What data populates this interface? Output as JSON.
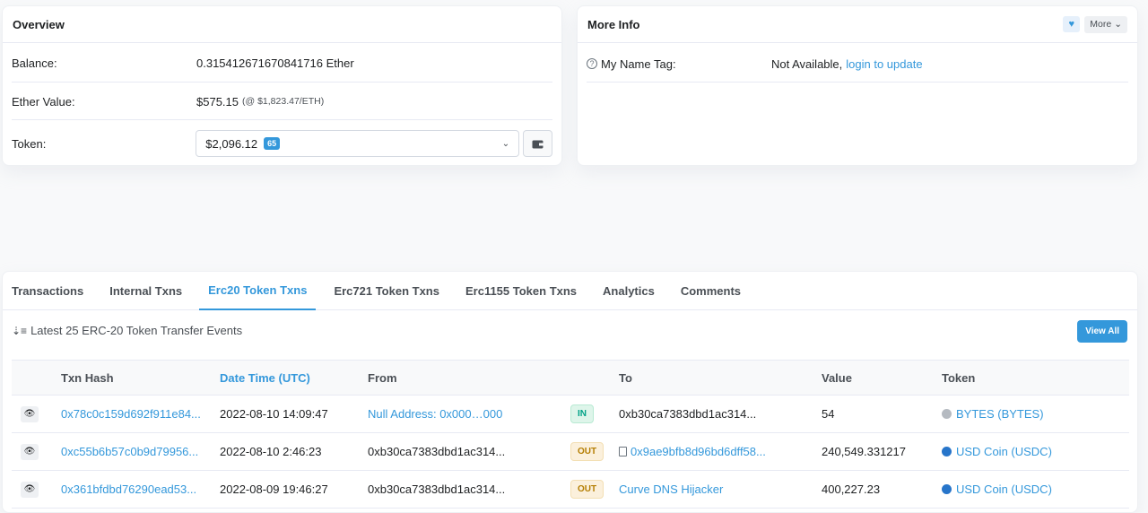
{
  "overview": {
    "title": "Overview",
    "balance_label": "Balance:",
    "balance_value": "0.315412671670841716 Ether",
    "ether_value_label": "Ether Value:",
    "ether_value": "$575.15",
    "ether_rate": "(@ $1,823.47/ETH)",
    "token_label": "Token:",
    "token_value": "$2,096.12",
    "token_count": "65"
  },
  "more_info": {
    "title": "More Info",
    "more_label": "More",
    "name_tag_label": "My Name Tag:",
    "name_tag_value": "Not Available,",
    "login_link": "login to update"
  },
  "tabs": [
    "Transactions",
    "Internal Txns",
    "Erc20 Token Txns",
    "Erc721 Token Txns",
    "Erc1155 Token Txns",
    "Analytics",
    "Comments"
  ],
  "active_tab": "Erc20 Token Txns",
  "latest_text": "Latest 25 ERC-20 Token Transfer Events",
  "view_all": "View All",
  "table": {
    "headers": {
      "hash": "Txn Hash",
      "datetime": "Date Time (UTC)",
      "from": "From",
      "to": "To",
      "value": "Value",
      "token": "Token"
    },
    "rows": [
      {
        "hash": "0x78c0c159d692f911e84...",
        "datetime": "2022-08-10 14:09:47",
        "from": "Null Address: 0x000…000",
        "dir": "IN",
        "to": "0xb30ca7383dbd1ac314...",
        "value": "54",
        "token": "BYTES (BYTES)"
      },
      {
        "hash": "0xc55b6b57c0b9d79956...",
        "datetime": "2022-08-10 2:46:23",
        "from": "0xb30ca7383dbd1ac314...",
        "dir": "OUT",
        "to": "0x9ae9bfb8d96bd6dff58...",
        "value": "240,549.331217",
        "token": "USD Coin (USDC)"
      },
      {
        "hash": "0x361bfdbd76290ead53...",
        "datetime": "2022-08-09 19:46:27",
        "from": "0xb30ca7383dbd1ac314...",
        "dir": "OUT",
        "to": "Curve DNS Hijacker",
        "value": "400,227.23",
        "token": "USD Coin (USDC)"
      }
    ]
  },
  "colors": {
    "accent": "#3498db",
    "in_badge": "#00a186",
    "out_badge": "#b47d00"
  }
}
